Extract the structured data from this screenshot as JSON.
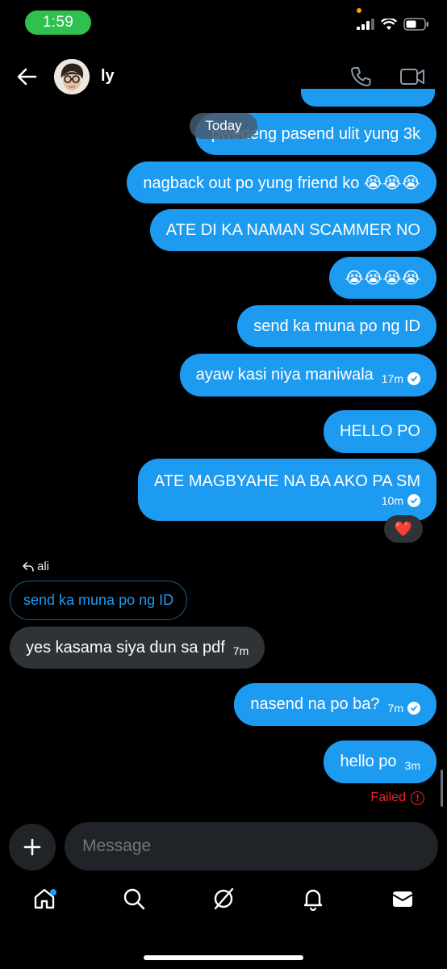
{
  "status_bar": {
    "time": "1:59"
  },
  "header": {
    "name": "ly",
    "avatar_icon": "avatar-icon"
  },
  "date_separator": "Today",
  "messages": [
    {
      "text": "pwedeng pasend ulit yung 3k"
    },
    {
      "text": "nagback out po yung friend ko 😭😭😭"
    },
    {
      "text": "ATE DI KA NAMAN SCAMMER NO"
    },
    {
      "text": "😭😭😭😭"
    },
    {
      "text": "send ka muna po ng ID"
    },
    {
      "text": "ayaw kasi niya maniwala",
      "time": "17m"
    },
    {
      "text": "HELLO PO"
    },
    {
      "text": "ATE MAGBYAHE NA BA AKO PA SM",
      "time": "10m",
      "reaction": "❤️"
    }
  ],
  "reply": {
    "replier": "ali",
    "quoted": "send ka muna po ng ID",
    "text": "yes kasama siya dun sa pdf",
    "time": "7m"
  },
  "messages_after": [
    {
      "text": "nasend na po ba?",
      "time": "7m"
    },
    {
      "text": "hello po",
      "time": "3m",
      "status": "Failed"
    }
  ],
  "composer": {
    "placeholder": "Message"
  },
  "colors": {
    "accent": "#1d9bf0",
    "incoming": "#2f3336",
    "error": "#f4212e",
    "status_pill": "#30c04f"
  }
}
